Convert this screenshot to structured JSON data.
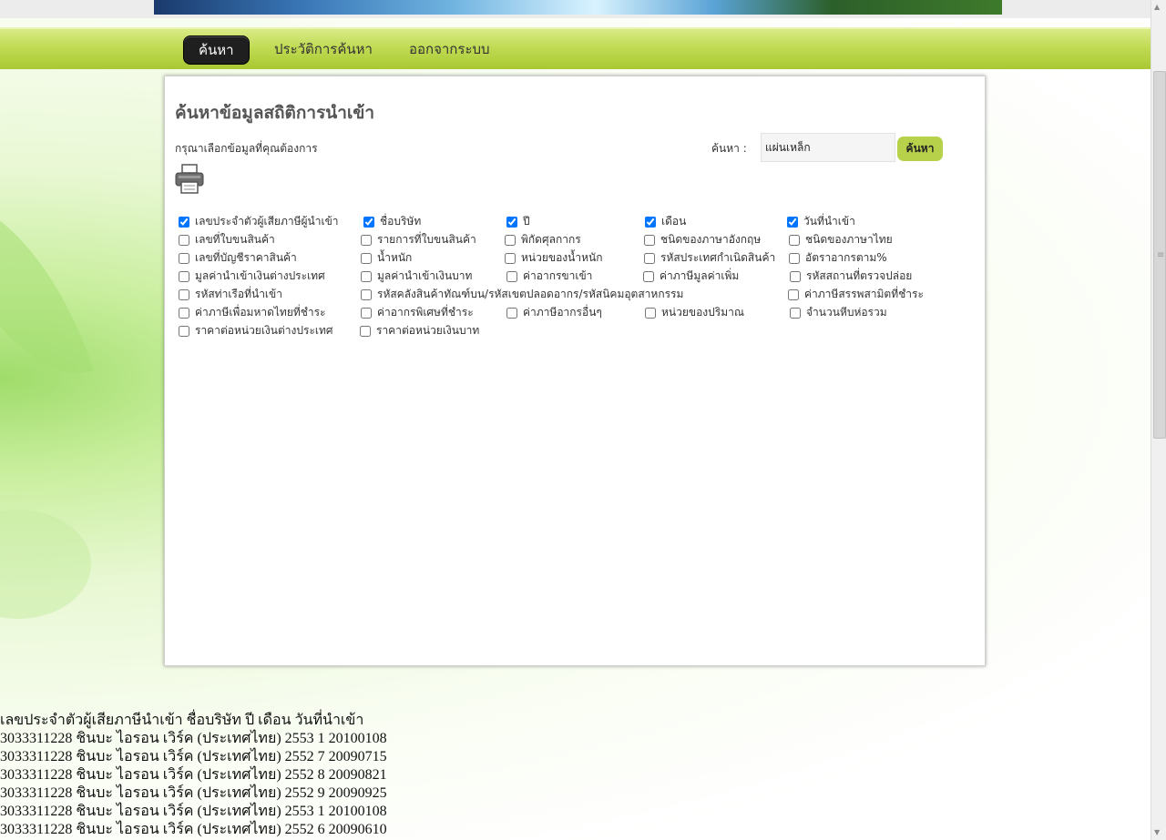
{
  "nav": {
    "items": [
      {
        "label": "ค้นหา",
        "active": true
      },
      {
        "label": "ประวัติการค้นหา",
        "active": false
      },
      {
        "label": "ออกจากระบบ",
        "active": false
      }
    ]
  },
  "panel": {
    "title": "ค้นหาข้อมูลสถิติการนำเข้า",
    "instruction": "กรุณาเลือกข้อมูลที่คุณต้องการ",
    "search_label": "ค้นหา :",
    "search_value": "แผ่นเหล็ก",
    "search_button": "ค้นหา",
    "print_icon": "printer-icon"
  },
  "fields": [
    {
      "label": "เลขประจำตัวผู้เสียภาษีผู้นำเข้า",
      "checked": true
    },
    {
      "label": "ชื่อบริษัท",
      "checked": true
    },
    {
      "label": "ปี",
      "checked": true
    },
    {
      "label": "เดือน",
      "checked": true
    },
    {
      "label": "วันที่นำเข้า",
      "checked": true
    },
    {
      "label": "เลขที่ใบขนสินค้า",
      "checked": false
    },
    {
      "label": "รายการที่ใบขนสินค้า",
      "checked": false
    },
    {
      "label": "พิกัดศุลกากร",
      "checked": false
    },
    {
      "label": "ชนิดของภาษาอังกฤษ",
      "checked": false
    },
    {
      "label": "ชนิดของภาษาไทย",
      "checked": false
    },
    {
      "label": "เลขที่บัญชีราคาสินค้า",
      "checked": false
    },
    {
      "label": "น้ำหนัก",
      "checked": false
    },
    {
      "label": "หน่วยของน้ำหนัก",
      "checked": false
    },
    {
      "label": "รหัสประเทศกำเนิดสินค้า",
      "checked": false
    },
    {
      "label": "อัตราอากรตาม%",
      "checked": false
    },
    {
      "label": "มูลค่านำเข้าเงินต่างประเทศ",
      "checked": false
    },
    {
      "label": "มูลค่านำเข้าเงินบาท",
      "checked": false
    },
    {
      "label": "ค่าอากรขาเข้า",
      "checked": false
    },
    {
      "label": "ค่าภาษีมูลค่าเพิ่ม",
      "checked": false
    },
    {
      "label": "รหัสสถานที่ตรวจปล่อย",
      "checked": false
    },
    {
      "label": "รหัสท่าเรือที่นำเข้า",
      "checked": false
    },
    {
      "label": "รหัสคลังสินค้าทัณฑ์บน/รหัสเขตปลอดอากร/รหัสนิคมอุตสาหกรรม",
      "checked": false
    },
    {
      "label": "ค่าภาษีสรรพสามิตที่ชำระ",
      "checked": false
    },
    {
      "label": "ค่าภาษีเพื่อมหาดไทยที่ชำระ",
      "checked": false
    },
    {
      "label": "ค่าอากรพิเศษที่ชำระ",
      "checked": false
    },
    {
      "label": "ค่าภาษีอากรอื่นๆ",
      "checked": false
    },
    {
      "label": "หน่วยของปริมาณ",
      "checked": false
    },
    {
      "label": "จำนวนหีบห่อรวม",
      "checked": false
    },
    {
      "label": "ราคาต่อหน่วยเงินต่างประเทศ",
      "checked": false
    },
    {
      "label": "ราคาต่อหน่วยเงินบาท",
      "checked": false
    }
  ],
  "results": {
    "header": "เลขประจำตัวผู้เสียภาษีนำเข้า ชื่อบริษัท ปี เดือน วันที่นำเข้า",
    "rows": [
      "3033311228 ชินบะ ไอรอน เวิร์ค (ประเทศไทย) 2553 1 20100108",
      "3033311228 ชินบะ ไอรอน เวิร์ค (ประเทศไทย) 2552 7 20090715",
      "3033311228 ชินบะ ไอรอน เวิร์ค (ประเทศไทย) 2552 8 20090821",
      "3033311228 ชินบะ ไอรอน เวิร์ค (ประเทศไทย) 2552 9 20090925",
      "3033311228 ชินบะ ไอรอน เวิร์ค (ประเทศไทย) 2553 1 20100108",
      "3033311228 ชินบะ ไอรอน เวิร์ค (ประเทศไทย) 2552 6 20090610"
    ]
  },
  "colors": {
    "nav_green": "#b4cf3c",
    "button_green": "#b7d24a",
    "active_nav": "#1f1f1f"
  }
}
